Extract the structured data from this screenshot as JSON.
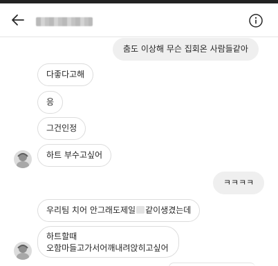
{
  "header": {
    "back_icon": "arrow-left-icon",
    "info_icon": "info-circle-icon"
  },
  "messages": [
    {
      "from": "me",
      "text": "춤도 이상해 무슨 집회온 사람들같아"
    },
    {
      "from": "them",
      "text": "다좋다고해"
    },
    {
      "from": "them",
      "text": "응"
    },
    {
      "from": "them",
      "text": "그건인정"
    },
    {
      "from": "them",
      "text": "하트 부수고싶어"
    },
    {
      "from": "me",
      "text": "ㅋㅋㅋㅋ"
    },
    {
      "from": "them",
      "text_before": "우리팀 치어 안그래도제일",
      "text_after": "같이생겼는데"
    },
    {
      "from": "them",
      "line1": "하트할때",
      "line2": "오함마들고가서어깨내려앉히고싶어"
    }
  ],
  "colors": {
    "incoming_bubble_bg": "#ffffff",
    "incoming_bubble_border": "#dcdcdc",
    "outgoing_bubble_bg": "#efefef",
    "text": "#262626",
    "top_bar": "#222222"
  }
}
